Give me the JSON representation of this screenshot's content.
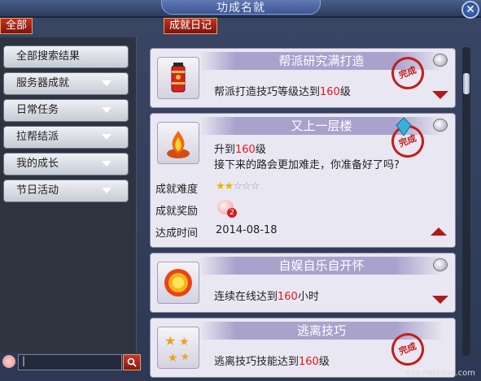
{
  "window": {
    "title": "功成名就"
  },
  "tabs": [
    {
      "label": "全部"
    },
    {
      "label": "成就日记"
    }
  ],
  "sidebar": {
    "items": [
      {
        "label": "全部搜索结果",
        "has_arrow": false
      },
      {
        "label": "服务器成就",
        "has_arrow": true
      },
      {
        "label": "日常任务",
        "has_arrow": true
      },
      {
        "label": "拉帮结派",
        "has_arrow": true
      },
      {
        "label": "我的成长",
        "has_arrow": true
      },
      {
        "label": "节日活动",
        "has_arrow": true
      }
    ]
  },
  "search": {
    "value": "|",
    "button_icon": "search-icon"
  },
  "achievements": [
    {
      "title": "帮派研究满打造",
      "desc_prefix": "帮派打造技巧等级达到",
      "desc_num": "160",
      "desc_suffix": "级",
      "icon": "firecracker-icon",
      "completed_stamp": "完成"
    },
    {
      "title": "又上一层楼",
      "line1_prefix": "升到",
      "line1_num": "160",
      "line1_suffix": "级",
      "line2": "接下来的路会更加难走，你准备好了吗?",
      "icon": "flame-icon",
      "completed_stamp": "完成",
      "difficulty_label": "成就难度",
      "difficulty_rating": 2,
      "difficulty_max": 5,
      "reward_label": "成就奖励",
      "reward_count": "2",
      "time_label": "达成时间",
      "time_value": "2014-08-18"
    },
    {
      "title": "自娱自乐自开怀",
      "desc_prefix": "连续在线达到",
      "desc_num": "160",
      "desc_suffix": "小时",
      "icon": "sun-icon"
    },
    {
      "title": "逃离技巧",
      "desc_prefix": "逃离技巧技能达到",
      "desc_num": "160",
      "desc_suffix": "级",
      "icon": "stars-icon",
      "completed_stamp": "完成"
    }
  ],
  "watermark": {
    "url": "xyq.netease.com"
  },
  "colors": {
    "accent_red": "#e01818",
    "stamp_red": "#c31d1d",
    "card_bg": "#e9e7f1"
  }
}
